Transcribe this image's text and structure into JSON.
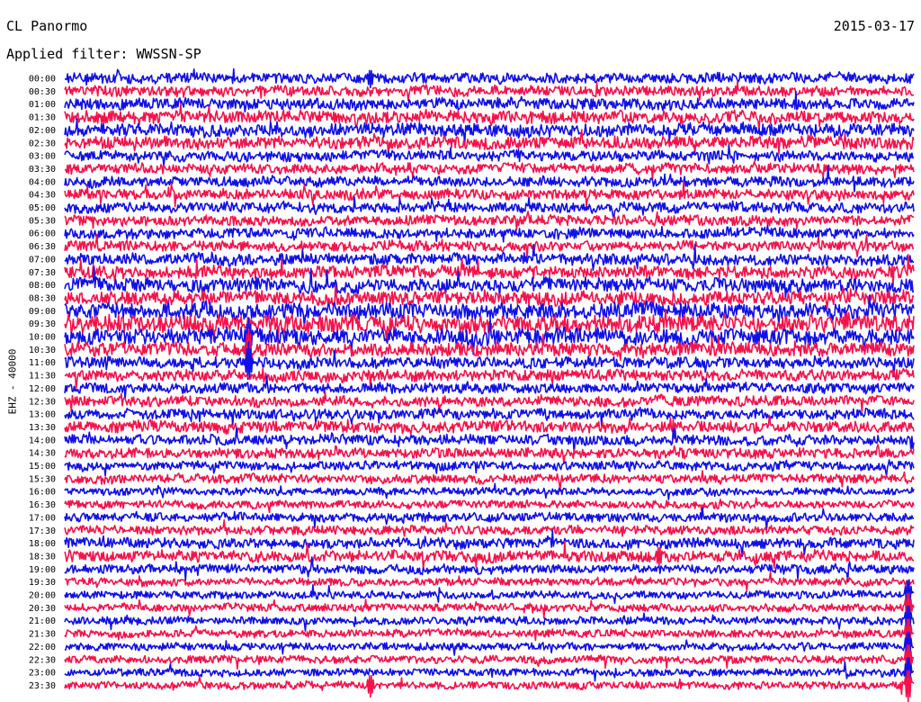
{
  "header": {
    "station": "CL Panormo",
    "date": "2015-03-17",
    "filter_text": "Applied filter: WWSSN-SP"
  },
  "colors": {
    "trace_a": "#1010e8",
    "trace_b": "#f5124a",
    "background": "#ffffff"
  },
  "chart_data": {
    "type": "line",
    "title": "CL Panormo",
    "subtitle": "Applied filter: WWSSN-SP",
    "date": "2015-03-17",
    "channel_label": "EHZ - 40000",
    "ylabel": "EHZ - 40000",
    "xlabel": "",
    "row_labels": [
      "00:00",
      "00:30",
      "01:00",
      "01:30",
      "02:00",
      "02:30",
      "03:00",
      "03:30",
      "04:00",
      "04:30",
      "05:00",
      "05:30",
      "06:00",
      "06:30",
      "07:00",
      "07:30",
      "08:00",
      "08:30",
      "09:00",
      "09:30",
      "10:00",
      "10:30",
      "11:00",
      "11:30",
      "12:00",
      "12:30",
      "13:00",
      "13:30",
      "14:00",
      "14:30",
      "15:00",
      "15:30",
      "16:00",
      "16:30",
      "17:00",
      "17:30",
      "18:00",
      "18:30",
      "19:00",
      "19:30",
      "20:00",
      "20:30",
      "21:00",
      "21:30",
      "22:00",
      "22:30",
      "23:00",
      "23:30"
    ],
    "row_colors": [
      "trace_a",
      "trace_b"
    ],
    "row_duration_minutes": 30,
    "row_amplitude": [
      0.8,
      0.8,
      0.9,
      1.0,
      1.0,
      1.0,
      0.8,
      0.8,
      0.8,
      0.8,
      0.8,
      0.8,
      0.8,
      0.8,
      0.9,
      1.0,
      1.1,
      1.1,
      1.3,
      1.4,
      1.3,
      1.1,
      0.9,
      0.9,
      0.8,
      0.8,
      0.8,
      0.9,
      0.8,
      0.8,
      0.7,
      0.7,
      0.6,
      0.6,
      0.7,
      0.7,
      0.8,
      0.9,
      0.7,
      0.6,
      0.6,
      0.6,
      0.6,
      0.6,
      0.6,
      0.6,
      0.6,
      0.6
    ],
    "events": [
      {
        "row": 20,
        "minute": 6.5,
        "amplitude": 3.2
      },
      {
        "row": 21,
        "minute": 6.5,
        "amplitude": 4.0
      },
      {
        "row": 22,
        "minute": 6.5,
        "amplitude": 3.5
      },
      {
        "row": 47,
        "minute": 10.8,
        "amplitude": 2.0
      },
      {
        "row": 0,
        "minute": 10.8,
        "amplitude": 1.6
      },
      {
        "row": 40,
        "minute": 29.8,
        "amplitude": 3.0
      },
      {
        "row": 41,
        "minute": 29.8,
        "amplitude": 3.0
      },
      {
        "row": 42,
        "minute": 29.8,
        "amplitude": 3.0
      },
      {
        "row": 43,
        "minute": 29.8,
        "amplitude": 3.0
      },
      {
        "row": 44,
        "minute": 29.8,
        "amplitude": 3.0
      },
      {
        "row": 45,
        "minute": 29.8,
        "amplitude": 3.0
      },
      {
        "row": 46,
        "minute": 29.8,
        "amplitude": 3.0
      },
      {
        "row": 47,
        "minute": 29.8,
        "amplitude": 3.0
      },
      {
        "row": 37,
        "minute": 21.0,
        "amplitude": 1.8
      }
    ]
  }
}
